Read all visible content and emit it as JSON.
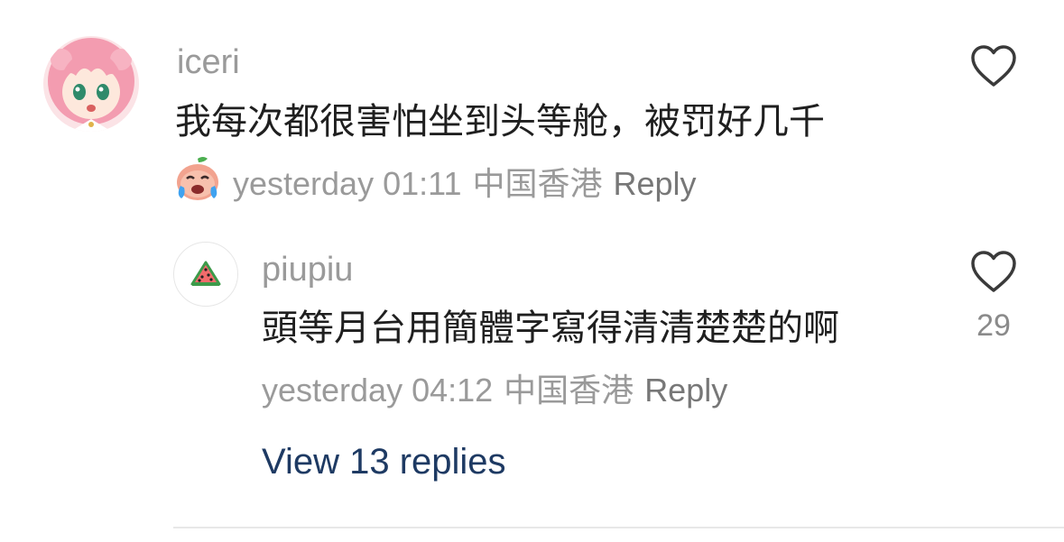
{
  "comment": {
    "username": "iceri",
    "avatar_icon": "anime-girl-avatar",
    "text": "我每次都很害怕坐到头等舱，被罚好几千",
    "badge_icon": "crying-peach-emoji",
    "time": "yesterday 01:11",
    "location": "中国香港",
    "reply_label": "Reply",
    "like_icon": "heart-outline-icon"
  },
  "reply": {
    "username": "piupiu",
    "avatar_icon": "watermelon-icon",
    "text": "頭等月台用簡體字寫得清清楚楚的啊",
    "time": "yesterday 04:12",
    "location": "中国香港",
    "reply_label": "Reply",
    "like_icon": "heart-outline-icon",
    "like_count": "29"
  },
  "view_replies_label": "View 13 replies",
  "colors": {
    "secondary_text": "#9a9a9a",
    "primary_text": "#1f1f1f",
    "link": "#1e3a63",
    "avatar_hair": "#f4a3b5"
  }
}
